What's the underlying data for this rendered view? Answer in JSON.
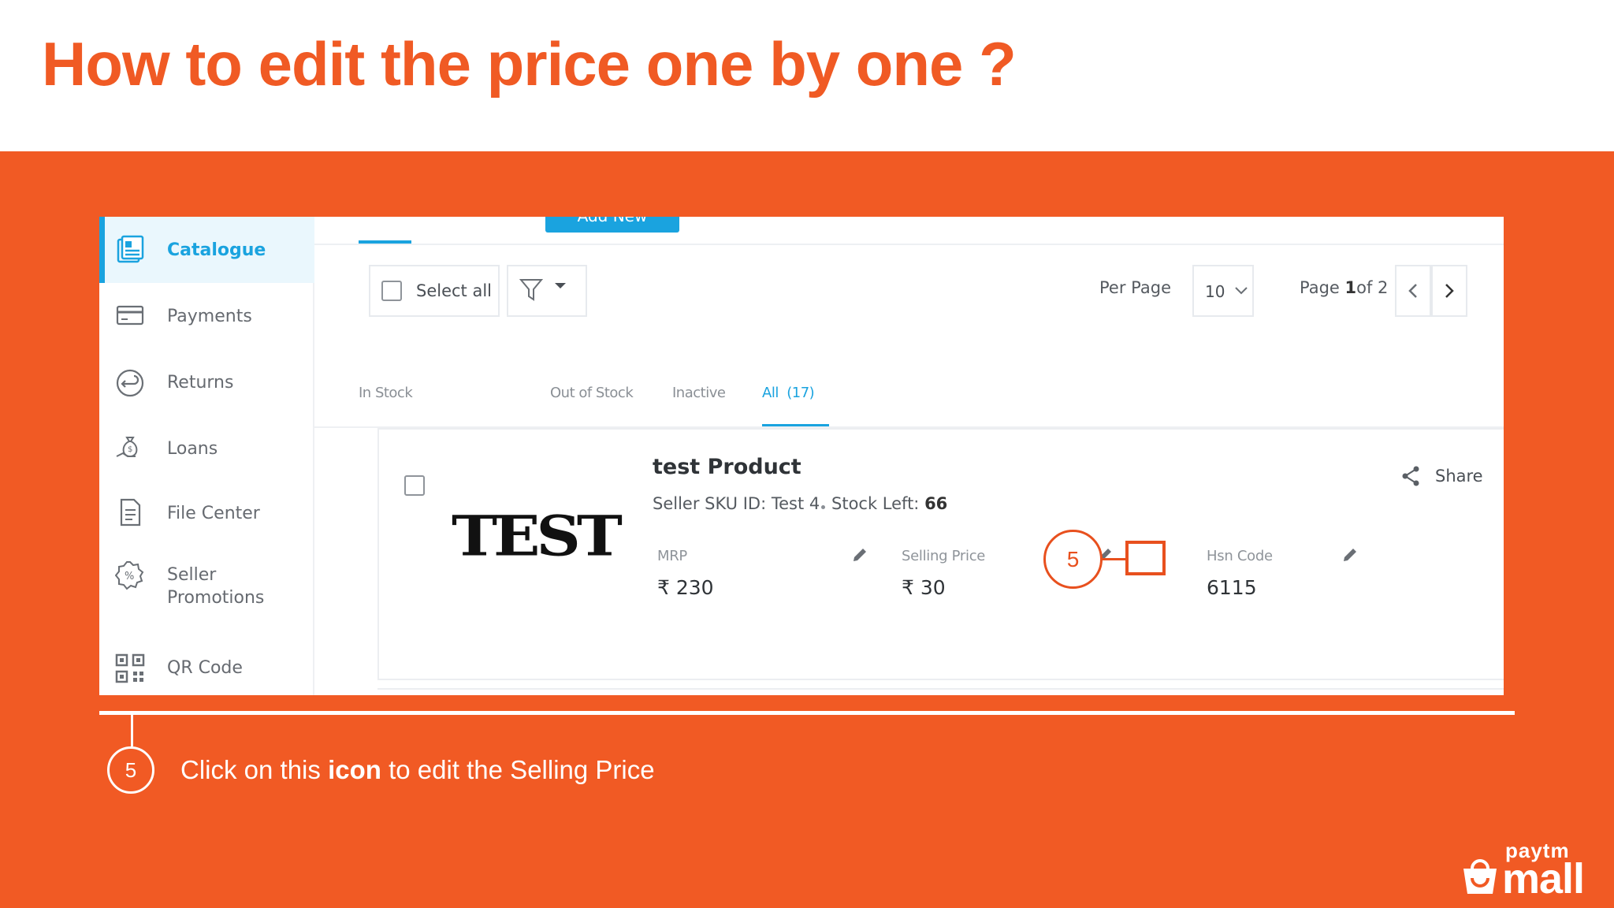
{
  "slide": {
    "title": "How to edit the price one by one ?",
    "instruction_pre": "Click on this ",
    "instruction_bold": "icon",
    "instruction_post": " to edit the Selling Price",
    "step_number": "5",
    "brand_top": "paytm",
    "brand_bottom": "mall",
    "accent_color": "#f15a24"
  },
  "sidebar": {
    "items": [
      {
        "label": "Catalogue",
        "icon": "catalogue-icon",
        "active": true
      },
      {
        "label": "Payments",
        "icon": "payments-card-icon"
      },
      {
        "label": "Returns",
        "icon": "returns-arrow-icon"
      },
      {
        "label": "Loans",
        "icon": "loans-money-bag-icon"
      },
      {
        "label": "File Center",
        "icon": "file-icon"
      },
      {
        "label": "Seller\nPromotions",
        "icon": "promotion-badge-icon"
      },
      {
        "label": "QR Code",
        "icon": "qr-code-icon"
      }
    ]
  },
  "toolbar": {
    "add_button_label": "Add New Product",
    "select_all_label": "Select all",
    "per_page_label": "Per Page",
    "per_page_value": "10",
    "page_label": "Page ",
    "page_current": "1",
    "page_of": "of 2"
  },
  "status_tabs": [
    {
      "label": "In Stock"
    },
    {
      "label": "Out of Stock"
    },
    {
      "label": "Inactive"
    },
    {
      "label": "All  (17)",
      "active": true
    }
  ],
  "product": {
    "logo_text": "TEST",
    "name": "test Product",
    "sku_line": "Seller SKU ID: Test 4",
    "stock_label": "Stock Left: ",
    "stock_value": "66",
    "mrp_label": "MRP",
    "mrp_value": "₹ 230",
    "selling_label": "Selling Price",
    "selling_value": "₹ 30",
    "hsn_label": "Hsn Code",
    "hsn_value": "6115",
    "share_label": "Share"
  },
  "annotation": {
    "callout_number": "5"
  }
}
